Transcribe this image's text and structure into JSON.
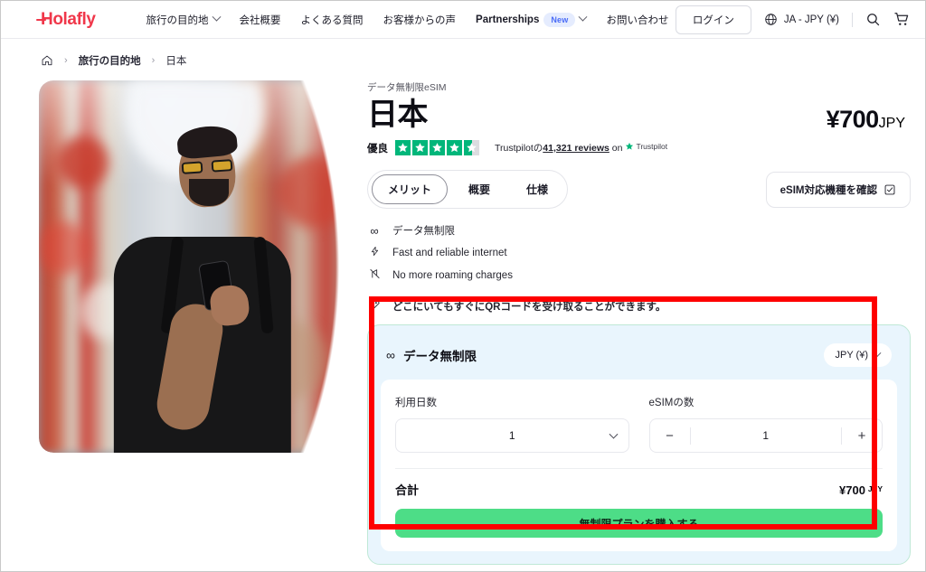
{
  "navbar": {
    "logo": "Holafly",
    "links": [
      {
        "label": "旅行の目的地",
        "has_chevron": true,
        "bold": false
      },
      {
        "label": "会社概要",
        "has_chevron": false,
        "bold": false
      },
      {
        "label": "よくある質問",
        "has_chevron": false,
        "bold": false
      },
      {
        "label": "お客様からの声",
        "has_chevron": false,
        "bold": false
      },
      {
        "label": "Partnerships",
        "has_chevron": true,
        "bold": true,
        "badge": "New"
      },
      {
        "label": "お問い合わせ",
        "has_chevron": false,
        "bold": false
      }
    ],
    "partnerships_badge": "New",
    "login_label": "ログイン",
    "language": "JA - JPY (¥)",
    "icons": {
      "globe": "globe-icon",
      "search": "search-icon",
      "cart": "cart-icon"
    },
    "cart_count": "0"
  },
  "breadcrumb": {
    "home_icon": "home-icon",
    "separator": "›",
    "items": [
      {
        "label": "旅行の目的地",
        "bold": true
      },
      {
        "label": "日本",
        "bold": false
      }
    ]
  },
  "product": {
    "eyebrow": "データ無制限eSIM",
    "title": "日本",
    "price": "¥700",
    "currency_code": "JPY"
  },
  "trustpilot": {
    "rating_word": "優良",
    "stars_full": 4,
    "stars_partial": 0.5,
    "text_prefix": "Trustpilotの",
    "reviews": "41,321 reviews",
    "text_on": "on",
    "brand": "Trustpilot",
    "star_color": "#00b67a"
  },
  "tabs": [
    {
      "label": "メリット",
      "active": true
    },
    {
      "label": "概要",
      "active": false
    },
    {
      "label": "仕様",
      "active": false
    }
  ],
  "esim_check": {
    "label": "eSIM対応機種を確認",
    "icon": "external-device-check-icon"
  },
  "features": [
    {
      "icon": "infinity-icon",
      "glyph": "∞",
      "text": "データ無制限",
      "bold": false
    },
    {
      "icon": "lightning-bolt-icon",
      "glyph": "⚡",
      "text": "Fast and reliable internet",
      "bold": false
    },
    {
      "icon": "no-roaming-icon",
      "glyph": "📵",
      "text": "No more roaming charges",
      "bold": false
    },
    {
      "icon": "rocket-icon",
      "glyph": "🚀",
      "text": "どこにいてもすぐにQRコードを受け取ることができます。",
      "bold": true
    }
  ],
  "purchase_panel": {
    "header_icon": "infinity-icon",
    "header_glyph": "∞",
    "header_title": "データ無制限",
    "currency_selector": {
      "label": "JPY (¥)",
      "icon": "chevron-down-icon"
    },
    "days_field": {
      "label": "利用日数",
      "value": "1"
    },
    "esim_qty_field": {
      "label": "eSIMの数",
      "value": "1",
      "minus": "−",
      "plus": "+"
    },
    "total_label": "合計",
    "total_value": "¥700",
    "total_currency": "JPY",
    "cta_label": "無制限プランを購入する",
    "cta_color": "#4ddd87",
    "panel_bg": "#e9f5fd"
  },
  "annotation": {
    "highlight_color": "#fe0000",
    "name": "purchase-panel-highlight"
  }
}
